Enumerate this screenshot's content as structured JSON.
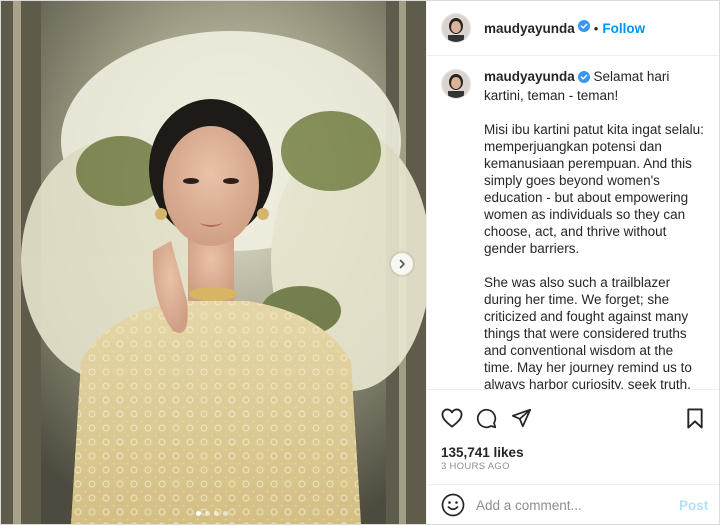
{
  "post": {
    "username": "maudyayunda",
    "follow_separator": "•",
    "follow_label": "Follow",
    "caption": {
      "first_line": "Selamat hari kartini, teman - teman!",
      "paragraphs": [
        "Misi ibu kartini patut kita ingat selalu: memperjuangkan potensi dan kemanusiaan perempuan. And this simply goes beyond women's education - but about empowering women as individuals so they can choose, act, and thrive without gender barriers.",
        "She was also such a trailblazer during her time. We forget; she criticized and fought against many things that were considered truths and conventional wisdom at the time. May her journey remind us to always harbor curiosity, seek truth, and challenge injustices that may be hidden in the supposed"
      ]
    },
    "likes": "135,741 likes",
    "timestamp": "3 HOURS AGO"
  },
  "comment": {
    "placeholder": "Add a comment...",
    "post_label": "Post"
  },
  "carousel": {
    "dots": 4,
    "active_index": 0
  },
  "icons": {
    "verified": "verified-badge-icon",
    "like": "heart-icon",
    "comment": "comment-bubble-icon",
    "share": "paper-plane-icon",
    "save": "bookmark-icon",
    "emoji": "smiley-icon",
    "next": "chevron-right-icon"
  },
  "colors": {
    "link_blue": "#0095f6",
    "post_disabled": "#b2dffc",
    "verified": "#3897f0",
    "muted": "#8e8e8e",
    "text": "#262626"
  }
}
